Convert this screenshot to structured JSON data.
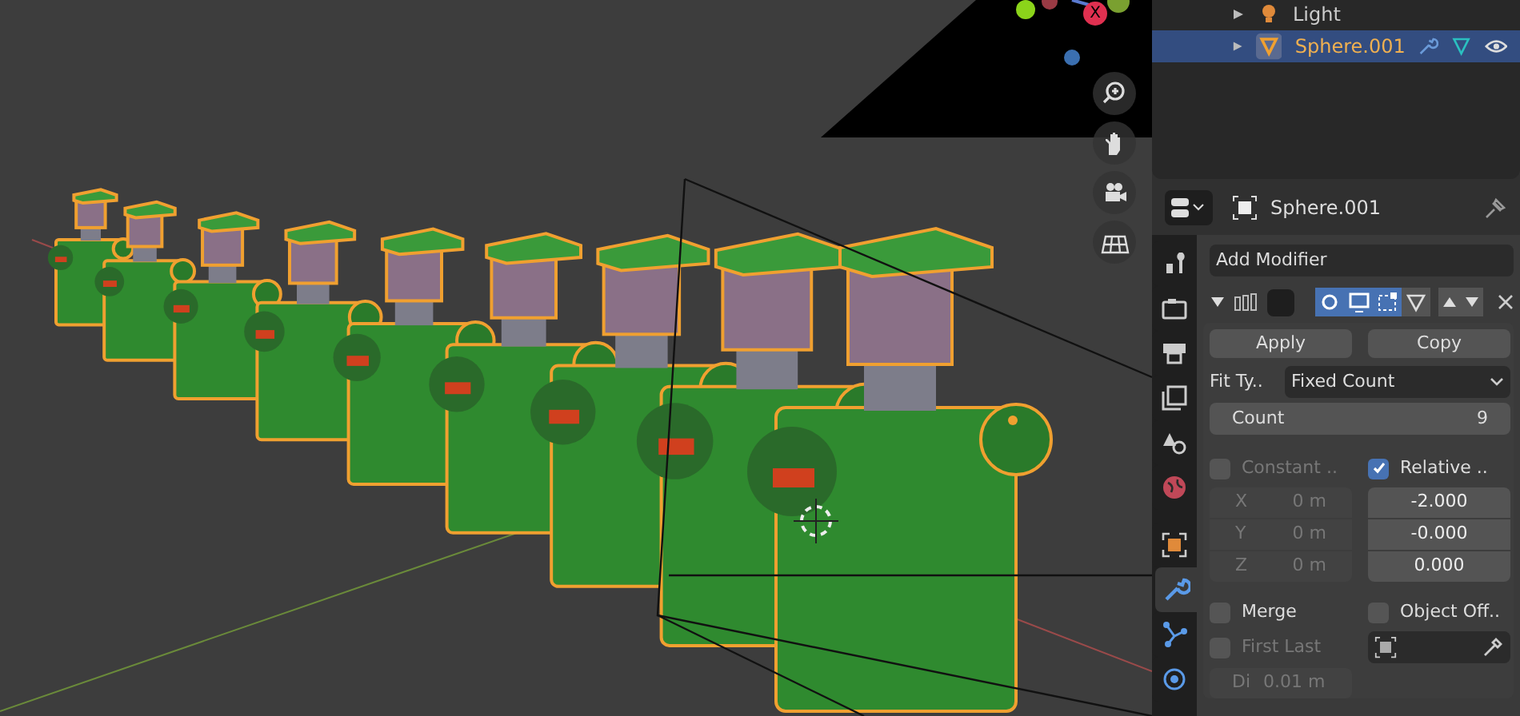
{
  "viewport": {
    "gizmo_axis_label": "X"
  },
  "outliner": {
    "rows": [
      {
        "label": "Light",
        "selected": false
      },
      {
        "label": "Sphere.001",
        "selected": true
      }
    ]
  },
  "properties": {
    "object_name": "Sphere.001",
    "tabs": [
      {
        "kind": "tool",
        "selected": false
      },
      {
        "kind": "render",
        "selected": false
      },
      {
        "kind": "output",
        "selected": false
      },
      {
        "kind": "view-layer",
        "selected": false
      },
      {
        "kind": "scene",
        "selected": false
      },
      {
        "kind": "world",
        "selected": false
      },
      {
        "kind": "object",
        "selected": false
      },
      {
        "kind": "modifier",
        "selected": true
      },
      {
        "kind": "particles",
        "selected": false
      },
      {
        "kind": "physics",
        "selected": false
      }
    ],
    "add_modifier": "Add Modifier",
    "modifier": {
      "expanded": true,
      "toggles": [
        {
          "kind": "camera",
          "on": true
        },
        {
          "kind": "monitor",
          "on": true
        },
        {
          "kind": "editmode",
          "on": true
        },
        {
          "kind": "vertices",
          "on": false
        }
      ],
      "apply": "Apply",
      "copy": "Copy",
      "fit_type": {
        "label": "Fit Ty..",
        "value": "Fixed Count"
      },
      "count": {
        "label": "Count",
        "value": "9"
      },
      "constant": {
        "label": "Constant ..",
        "checked": false,
        "disabled": true,
        "rows": [
          {
            "axis": "X",
            "value": "0 m"
          },
          {
            "axis": "Y",
            "value": "0 m"
          },
          {
            "axis": "Z",
            "value": "0 m"
          }
        ]
      },
      "relative": {
        "label": "Relative ..",
        "checked": true,
        "values": [
          "-2.000",
          "-0.000",
          "0.000"
        ]
      },
      "merge": {
        "label": "Merge",
        "checked": false
      },
      "object_offset": {
        "label": "Object Off..",
        "checked": false
      },
      "first_last": {
        "label": "First Last",
        "checked": false,
        "disabled": true
      },
      "distance": {
        "label": "Di",
        "value": "0.01 m",
        "disabled": true
      }
    }
  }
}
